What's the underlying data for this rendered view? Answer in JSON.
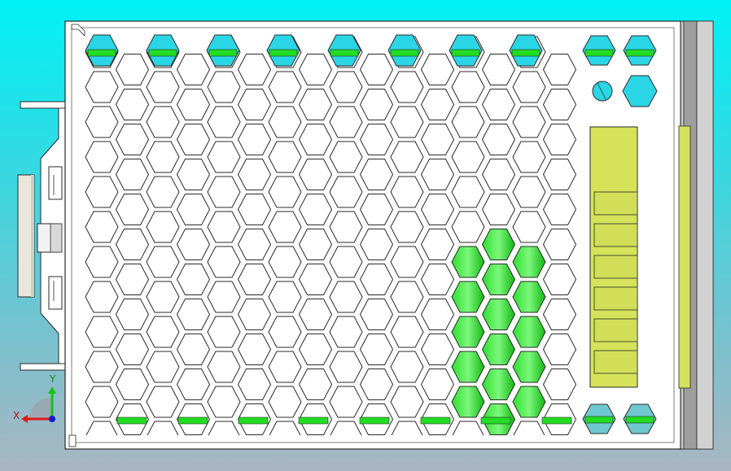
{
  "viewport": {
    "background_top": "#00f2f6",
    "background_bottom": "#a8b6c2"
  },
  "model": {
    "hex_border_color": "#ffffff",
    "hex_outline_color": "#2a2a2a",
    "vent_green": "#22dd22",
    "capacitor_green": "#1ec81e",
    "pcb_yellow": "#d6e35a",
    "rail_gray": "#b9b9b9"
  },
  "triad": {
    "x_label": "X",
    "y_label": "Y",
    "x_color": "#e01818",
    "y_color": "#18c018",
    "z_color": "#1818d0"
  }
}
